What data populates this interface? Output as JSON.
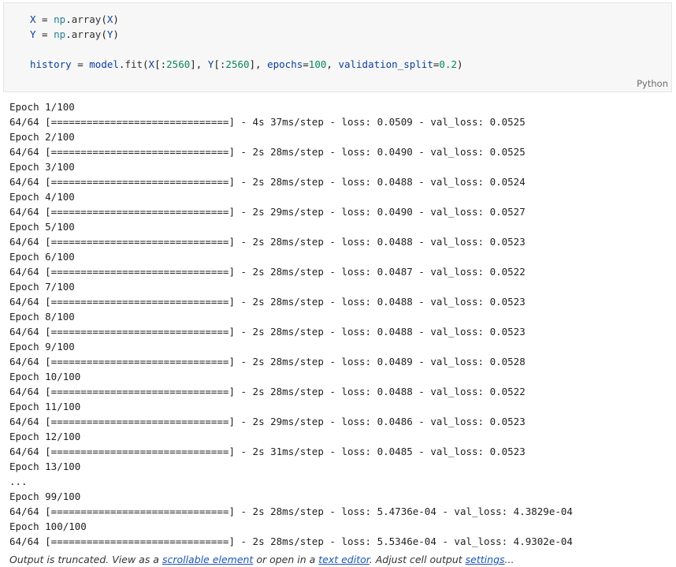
{
  "code": {
    "lines": [
      [
        {
          "t": "X",
          "c": "var"
        },
        {
          "t": " = ",
          "c": "op"
        },
        {
          "t": "np",
          "c": "builtin"
        },
        {
          "t": ".",
          "c": "op"
        },
        {
          "t": "array",
          "c": "fn"
        },
        {
          "t": "(",
          "c": "op"
        },
        {
          "t": "X",
          "c": "var"
        },
        {
          "t": ")",
          "c": "op"
        }
      ],
      [
        {
          "t": "Y",
          "c": "var"
        },
        {
          "t": " = ",
          "c": "op"
        },
        {
          "t": "np",
          "c": "builtin"
        },
        {
          "t": ".",
          "c": "op"
        },
        {
          "t": "array",
          "c": "fn"
        },
        {
          "t": "(",
          "c": "op"
        },
        {
          "t": "Y",
          "c": "var"
        },
        {
          "t": ")",
          "c": "op"
        }
      ],
      [],
      [
        {
          "t": "history",
          "c": "var"
        },
        {
          "t": " = ",
          "c": "op"
        },
        {
          "t": "model",
          "c": "var"
        },
        {
          "t": ".",
          "c": "op"
        },
        {
          "t": "fit",
          "c": "fn"
        },
        {
          "t": "(",
          "c": "op"
        },
        {
          "t": "X",
          "c": "var"
        },
        {
          "t": "[:",
          "c": "op"
        },
        {
          "t": "2560",
          "c": "num"
        },
        {
          "t": "], ",
          "c": "op"
        },
        {
          "t": "Y",
          "c": "var"
        },
        {
          "t": "[:",
          "c": "op"
        },
        {
          "t": "2560",
          "c": "num"
        },
        {
          "t": "], ",
          "c": "op"
        },
        {
          "t": "epochs",
          "c": "var"
        },
        {
          "t": "=",
          "c": "op"
        },
        {
          "t": "100",
          "c": "num"
        },
        {
          "t": ", ",
          "c": "op"
        },
        {
          "t": "validation_split",
          "c": "var"
        },
        {
          "t": "=",
          "c": "op"
        },
        {
          "t": "0.2",
          "c": "num"
        },
        {
          "t": ")",
          "c": "op"
        }
      ]
    ],
    "language": "Python"
  },
  "output": {
    "lines": [
      "Epoch 1/100",
      "64/64 [==============================] - 4s 37ms/step - loss: 0.0509 - val_loss: 0.0525",
      "Epoch 2/100",
      "64/64 [==============================] - 2s 28ms/step - loss: 0.0490 - val_loss: 0.0525",
      "Epoch 3/100",
      "64/64 [==============================] - 2s 28ms/step - loss: 0.0488 - val_loss: 0.0524",
      "Epoch 4/100",
      "64/64 [==============================] - 2s 29ms/step - loss: 0.0490 - val_loss: 0.0527",
      "Epoch 5/100",
      "64/64 [==============================] - 2s 28ms/step - loss: 0.0488 - val_loss: 0.0523",
      "Epoch 6/100",
      "64/64 [==============================] - 2s 28ms/step - loss: 0.0487 - val_loss: 0.0522",
      "Epoch 7/100",
      "64/64 [==============================] - 2s 28ms/step - loss: 0.0488 - val_loss: 0.0523",
      "Epoch 8/100",
      "64/64 [==============================] - 2s 28ms/step - loss: 0.0488 - val_loss: 0.0523",
      "Epoch 9/100",
      "64/64 [==============================] - 2s 28ms/step - loss: 0.0489 - val_loss: 0.0528",
      "Epoch 10/100",
      "64/64 [==============================] - 2s 28ms/step - loss: 0.0488 - val_loss: 0.0522",
      "Epoch 11/100",
      "64/64 [==============================] - 2s 29ms/step - loss: 0.0486 - val_loss: 0.0523",
      "Epoch 12/100",
      "64/64 [==============================] - 2s 31ms/step - loss: 0.0485 - val_loss: 0.0523",
      "Epoch 13/100",
      "...",
      "Epoch 99/100",
      "64/64 [==============================] - 2s 28ms/step - loss: 5.4736e-04 - val_loss: 4.3829e-04",
      "Epoch 100/100",
      "64/64 [==============================] - 2s 28ms/step - loss: 5.5346e-04 - val_loss: 4.9302e-04"
    ]
  },
  "truncation": {
    "prefix": "Output is truncated. View as a ",
    "scrollable_link": "scrollable element",
    "middle": " or open in a ",
    "editor_link": "text editor",
    "middle2": ". Adjust cell output ",
    "settings_link": "settings",
    "suffix": "..."
  }
}
